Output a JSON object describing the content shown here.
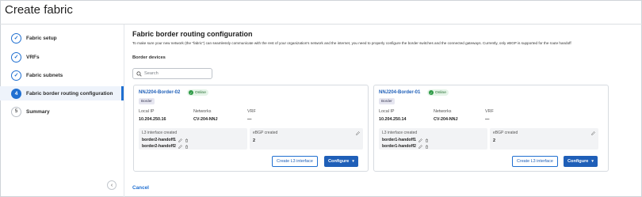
{
  "page": {
    "title": "Create fabric"
  },
  "sidebar": {
    "items": [
      {
        "label": "Fabric setup",
        "state": "done",
        "marker": "✓"
      },
      {
        "label": "VRFs",
        "state": "done",
        "marker": "✓"
      },
      {
        "label": "Fabric subnets",
        "state": "done",
        "marker": "✓"
      },
      {
        "label": "Fabric border routing configuration",
        "state": "active",
        "marker": "4"
      },
      {
        "label": "Summary",
        "state": "todo",
        "marker": "5"
      }
    ],
    "collapse_glyph": "‹"
  },
  "main": {
    "title": "Fabric border routing configuration",
    "description": "To make sure your new network (the \"fabric\") can seamlessly communicate with the rest of your organization's network and the internet, you need to properly configure the border switches and the connected gateways. Currently, only eBGP is supported for the route handoff",
    "section_label": "Border devices",
    "search_placeholder": "Search"
  },
  "cards": [
    {
      "name": "NNJ204-Border-02",
      "status": "Online",
      "role": "Border",
      "local_ip_label": "Local IP",
      "local_ip": "10.204.250.16",
      "networks_label": "Networks",
      "networks": "CV-204-NNJ",
      "vrf_label": "VRF",
      "vrf": "—",
      "l3_label": "L3 interface created",
      "handoffs": [
        "border2-handoff1",
        "border2-handoff2"
      ],
      "ebgp_label": "eBGP created",
      "ebgp_count": "2",
      "create_l3_label": "Create L3 interface",
      "configure_label": "Configure"
    },
    {
      "name": "NNJ204-Border-01",
      "status": "Online",
      "role": "Border",
      "local_ip_label": "Local IP",
      "local_ip": "10.204.250.14",
      "networks_label": "Networks",
      "networks": "CV-204-NNJ",
      "vrf_label": "VRF",
      "vrf": "—",
      "l3_label": "L3 interface created",
      "handoffs": [
        "border1-handoff1",
        "border1-handoff2"
      ],
      "ebgp_label": "eBGP created",
      "ebgp_count": "2",
      "create_l3_label": "Create L3 interface",
      "configure_label": "Configure"
    }
  ],
  "footer": {
    "cancel_label": "Cancel"
  },
  "colors": {
    "accent": "#1f6fd1",
    "online": "#2e9a46",
    "panel": "#f2f3f5"
  }
}
